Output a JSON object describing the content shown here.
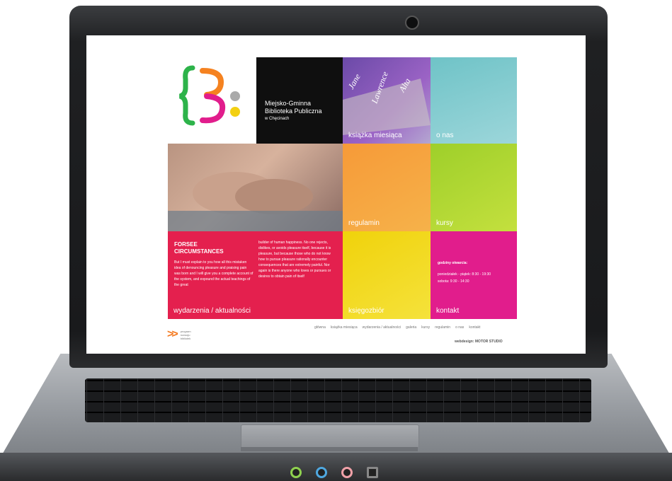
{
  "logo": {
    "colors": [
      "#2db34a",
      "#f58220",
      "#e11d8c",
      "#f3d012",
      "#aaaaaa"
    ]
  },
  "title_tile": {
    "line1": "Miejsko-Gminna",
    "line2": "Biblioteka Publiczna",
    "line3": "w Chęcinach"
  },
  "tiles": {
    "ksiazka": "książka miesiąca",
    "onas": "o nas",
    "regulamin": "regulamin",
    "kursy": "kursy",
    "news": "wydarzenia / aktualności",
    "ksiegozbior": "księgozbiór",
    "kontakt": "kontakt"
  },
  "book_text": [
    "Jane",
    "Lawrence",
    "Alta"
  ],
  "news": {
    "title": "FORSEE CIRCUMSTANCES",
    "col1": "But I must explain to you how all this mistaken idea of denouncing pleasure and praising pain was born and I will give you a complete account of the system, and expound the actual teachings of the great",
    "col2": "builder of human happiness. No one rejects, dislikes, or avoids pleasure itself, because it is pleasure, but because those who do not know how to pursue pleasure rationally encounter consequences that are extremely painful. Nor again is there anyone who loves or pursues or desires to obtain pain of itself"
  },
  "hours": {
    "title": "godziny otwarcia:",
    "line1": "poniedziałek - piątek: 8:30 - 19:30",
    "line2": "sobota: 9:30 - 14:30"
  },
  "footer": {
    "logo_text_1": "program",
    "logo_text_2": "rozwoju",
    "logo_text_3": "bibliotek",
    "nav": [
      "główna",
      "książka miesiąca",
      "wydarzenia / aktualności",
      "galeria",
      "kursy",
      "regulamin",
      "o nas",
      "kontakt"
    ],
    "credit": "webdesign: MOTOR STUDIO"
  },
  "colors": {
    "news_red": "#e4204e",
    "kontakt_magenta": "#e11d8c",
    "regulamin_orange": "#f69a38",
    "kursy_green": "#9ecf2a",
    "ksiegozbior_yellow": "#f0d20b",
    "onas_teal": "#6fc3c7"
  }
}
